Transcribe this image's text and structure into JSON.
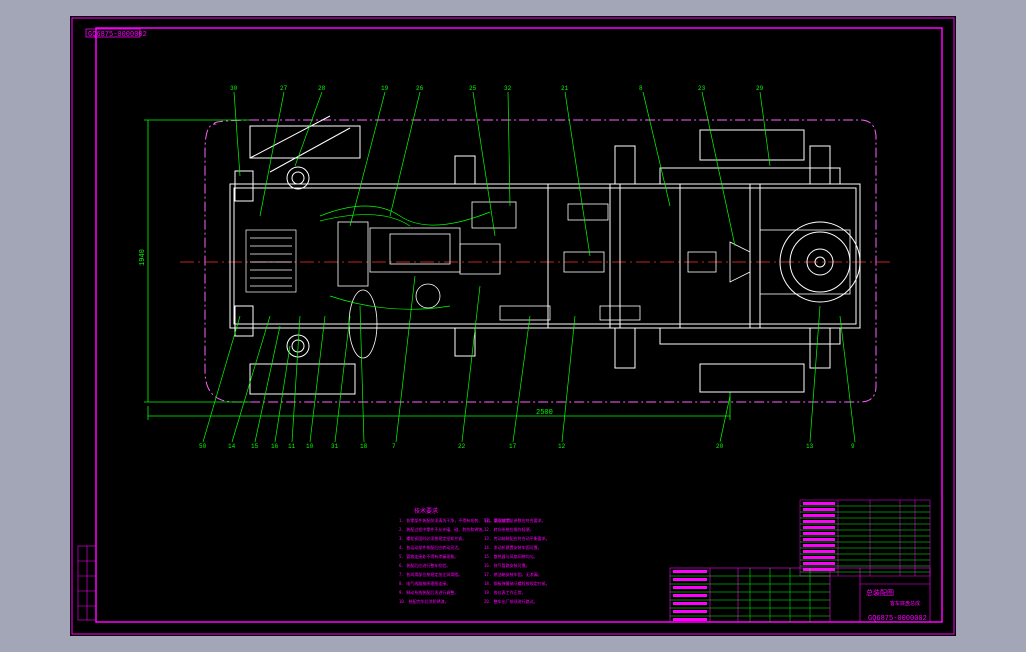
{
  "sheet": {
    "code_topleft": "GQ6875-0000002",
    "code_bottomright": "GQ6875-0000002",
    "title_label": "总装配图",
    "title_sub": "客车底盘总成"
  },
  "dimensions": {
    "overall_length": "2500",
    "overall_width": "1940"
  },
  "balloons": {
    "top": [
      "30",
      "27",
      "28",
      "19",
      "26",
      "25",
      "32",
      "21",
      "8",
      "23",
      "29"
    ],
    "bottom": [
      "50",
      "14",
      "15",
      "16",
      "11",
      "10",
      "31",
      "18",
      "7",
      "22",
      "17",
      "12",
      "20",
      "13",
      "9"
    ]
  },
  "notes": {
    "heading": "技术要求",
    "col1": [
      "1. 各零部件装配前须清洗干净，不得有毛刺、飞边、氧化皮等。",
      "2. 装配过程中零件不允许磕、碰、划伤和锈蚀。",
      "3. 螺栓紧固时必须按规定扭矩拧紧。",
      "4. 各运动部件装配后应转动灵活。",
      "5. 管路连接处不得有渗漏现象。",
      "6. 装配后应进行整车检验。",
      "7. 各润滑部位按规定加注润滑脂。",
      "8. 电气线路按原理图连接。",
      "9. 制动系统装配后须进行调整。",
      "10. 装配完毕后涂防锈漆。"
    ],
    "col2": [
      "11. 前后轮定位参数应符合要求。",
      "12. 转向系统应操作轻便。",
      "13. 传动轴装配应符合动平衡要求。",
      "14. 发动机悬置安装牢固可靠。",
      "15. 散热器与风扇间隙均匀。",
      "16. 排气管路安装可靠。",
      "17. 燃油箱安装牢固，无渗漏。",
      "18. 钢板弹簧骑马螺栓按规定拧紧。",
      "19. 各仪表工作正常。",
      "20. 整车出厂前须进行路试。"
    ]
  },
  "colors": {
    "frame": "#ffffff",
    "dimension": "#00ff00",
    "center": "#ff3030",
    "border": "#ff00ff",
    "outline": "#ff60ff"
  }
}
